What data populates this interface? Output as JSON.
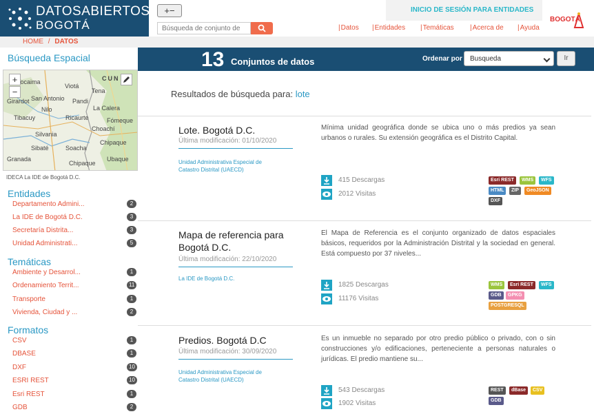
{
  "header": {
    "logo_line1": "DATOSABIERTOS",
    "logo_line2": "BOGOTÁ",
    "zoom_toggle": "+−",
    "session_link": "INICIO DE SESIÓN PARA ENTIDADES",
    "search_placeholder": "Búsqueda de conjunto de",
    "nav": [
      "Datos",
      "Entidades",
      "Temáticas",
      "Acerca de",
      "Ayuda"
    ],
    "city_logo": "BOGOTÁ"
  },
  "breadcrumb": {
    "home": "HOME",
    "sep": "/",
    "current": "DATOS"
  },
  "sidebar": {
    "spatial_title": "Búsqueda Espacial",
    "map": {
      "labels": [
        "CUN",
        "Tocaima",
        "Viotá",
        "Tena",
        "San Antonio",
        "Girardot",
        "Nilo",
        "Tibacuy",
        "Ricaurte",
        "Silvania",
        "Sibaté",
        "Granada",
        "Soacha",
        "Chipaque",
        "Ubaque",
        "La Calera",
        "Fómeque",
        "Choachí",
        "Chipaque",
        "Pandi"
      ],
      "caption": "IDECA La IDE de Bogotá D.C.",
      "zoom_in": "+",
      "zoom_out": "−"
    },
    "entidades_title": "Entidades",
    "entidades": [
      {
        "label": "Departamento Admini...",
        "count": "2"
      },
      {
        "label": "La IDE de Bogotá D.C.",
        "count": "3"
      },
      {
        "label": "Secretaría Distrita...",
        "count": "3"
      },
      {
        "label": "Unidad Administrati...",
        "count": "5"
      }
    ],
    "tematicas_title": "Temáticas",
    "tematicas": [
      {
        "label": "Ambiente y Desarrol...",
        "count": "1"
      },
      {
        "label": "Ordenamiento Territ...",
        "count": "11"
      },
      {
        "label": "Transporte",
        "count": "1"
      },
      {
        "label": "Vivienda, Ciudad y ...",
        "count": "2"
      }
    ],
    "formatos_title": "Formatos",
    "formatos": [
      {
        "label": "CSV",
        "count": "1"
      },
      {
        "label": "DBASE",
        "count": "1"
      },
      {
        "label": "DXF",
        "count": "10"
      },
      {
        "label": "ESRI REST",
        "count": "10"
      },
      {
        "label": "Esri REST",
        "count": "1"
      },
      {
        "label": "GDB",
        "count": "2"
      }
    ]
  },
  "main": {
    "count": "13",
    "count_label": "Conjuntos de datos",
    "sort_label": "Ordenar por",
    "sort_value": "Busqueda",
    "sort_button": "Ir",
    "results_prefix": "Resultados de búsqueda para:",
    "results_term": "lote",
    "datasets": [
      {
        "title": "Lote. Bogotá D.C.",
        "modified": "Última modificación: 01/10/2020",
        "org": "Unidad Administrativa Especial de Catastro Distrital (UAECD)",
        "description": "Mínima unidad geográfica donde se ubica uno o más predios ya sean urbanos o rurales. Su extensión geográfica es el Distrito Capital.",
        "downloads": "415 Descargas",
        "visits": "2012 Visitas",
        "formats": [
          {
            "label": "Esri REST",
            "color": "#8b2a2a"
          },
          {
            "label": "WMS",
            "color": "#9bc53d"
          },
          {
            "label": "WFS",
            "color": "#2ab7c9"
          },
          {
            "label": "HTML",
            "color": "#4a8ac4"
          },
          {
            "label": "ZIP",
            "color": "#666666"
          },
          {
            "label": "GeoJSON",
            "color": "#f08a24"
          },
          {
            "label": "DXF",
            "color": "#555555"
          }
        ]
      },
      {
        "title": "Mapa de referencia para Bogotá D.C.",
        "modified": "Última modificación: 22/10/2020",
        "org": "La IDE de Bogotá D.C.",
        "description": "El Mapa de Referencia es el conjunto organizado de datos espaciales básicos, requeridos por la Administración Distrital y la sociedad en general. Está compuesto por 37 niveles...",
        "downloads": "1825 Descargas",
        "visits": "11176 Visitas",
        "formats": [
          {
            "label": "WMS",
            "color": "#9bc53d"
          },
          {
            "label": "Esri REST",
            "color": "#8b2a2a"
          },
          {
            "label": "WFS",
            "color": "#2ab7c9"
          },
          {
            "label": "GDB",
            "color": "#5a5a8a"
          },
          {
            "label": "GPKG",
            "color": "#f48fb1"
          },
          {
            "label": "POSTGRESQL",
            "color": "#e8a040"
          }
        ]
      },
      {
        "title": "Predios. Bogotá D.C",
        "modified": "Última modificación: 30/09/2020",
        "org": "Unidad Administrativa Especial de Catastro Distrital (UAECD)",
        "description": "Es un inmueble no separado por otro predio público o privado, con o sin construcciones y/o edificaciones, perteneciente a personas naturales o jurídicas. El predio mantiene su...",
        "downloads": "543 Descargas",
        "visits": "1902 Visitas",
        "formats": [
          {
            "label": "REST",
            "color": "#555555"
          },
          {
            "label": "dBase",
            "color": "#8b2a2a"
          },
          {
            "label": "CSV",
            "color": "#e8c020"
          },
          {
            "label": "GDB",
            "color": "#5a5a8a"
          }
        ]
      }
    ]
  }
}
